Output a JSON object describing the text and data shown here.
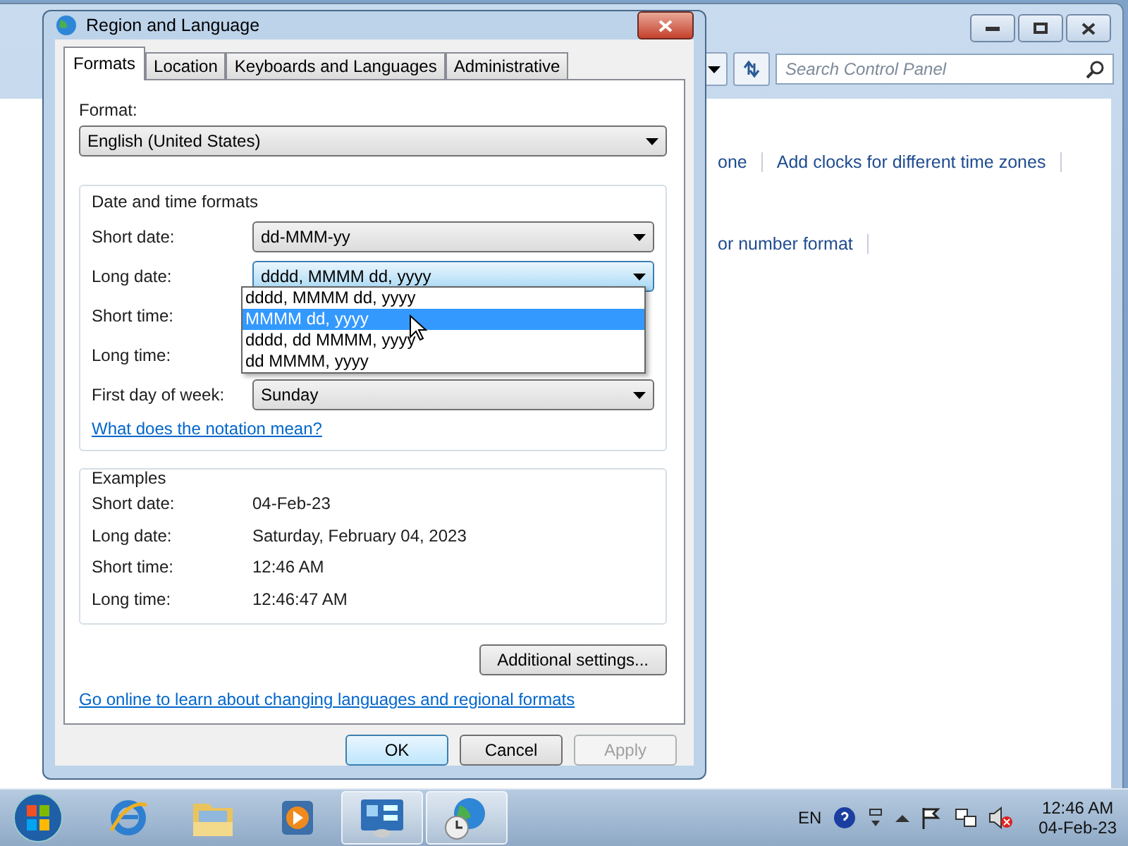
{
  "background_window": {
    "search": {
      "placeholder": "Search Control Panel"
    },
    "links": [
      {
        "text": "one"
      },
      {
        "text": "Add clocks for different time zones"
      },
      {
        "text": "or number format"
      }
    ]
  },
  "dialog": {
    "title": "Region and Language",
    "tabs": [
      {
        "label": "Formats",
        "selected": true
      },
      {
        "label": "Location",
        "selected": false
      },
      {
        "label": "Keyboards and Languages",
        "selected": false
      },
      {
        "label": "Administrative",
        "selected": false
      }
    ],
    "format": {
      "label": "Format:",
      "value": "English (United States)"
    },
    "date_time_formats": {
      "title": "Date and time formats",
      "rows": [
        {
          "label": "Short date:",
          "value": "dd-MMM-yy",
          "open": false
        },
        {
          "label": "Long date:",
          "value": "dddd, MMMM dd, yyyy",
          "open": true
        },
        {
          "label": "Short time:"
        },
        {
          "label": "Long time:"
        },
        {
          "label": "First day of week:",
          "value": "Sunday",
          "open": false
        }
      ],
      "dropdown_options": [
        {
          "text": "dddd, MMMM dd, yyyy",
          "selected": false
        },
        {
          "text": "MMMM dd, yyyy",
          "selected": true
        },
        {
          "text": "dddd, dd MMMM, yyyy",
          "selected": false
        },
        {
          "text": "dd MMMM, yyyy",
          "selected": false
        }
      ],
      "link": "What does the notation mean?"
    },
    "examples": {
      "title": "Examples",
      "rows": [
        {
          "label": "Short date:",
          "value": "04-Feb-23"
        },
        {
          "label": "Long date:",
          "value": "Saturday, February 04, 2023"
        },
        {
          "label": "Short time:",
          "value": "12:46 AM"
        },
        {
          "label": "Long time:",
          "value": "12:46:47 AM"
        }
      ]
    },
    "additional_settings": "Additional settings...",
    "online_link": "Go online to learn about changing languages and regional formats",
    "buttons": [
      {
        "label": "OK",
        "kind": "default"
      },
      {
        "label": "Cancel",
        "kind": "normal"
      },
      {
        "label": "Apply",
        "kind": "disabled"
      }
    ]
  },
  "taskbar": {
    "apps": [
      {
        "kind": "browser",
        "open": false
      },
      {
        "kind": "folder",
        "open": false
      },
      {
        "kind": "media",
        "open": false
      },
      {
        "kind": "control-panel",
        "open": true
      },
      {
        "kind": "globe",
        "open": true
      }
    ],
    "language": "EN",
    "clock": {
      "time": "12:46 AM",
      "date": "04-Feb-23"
    }
  }
}
